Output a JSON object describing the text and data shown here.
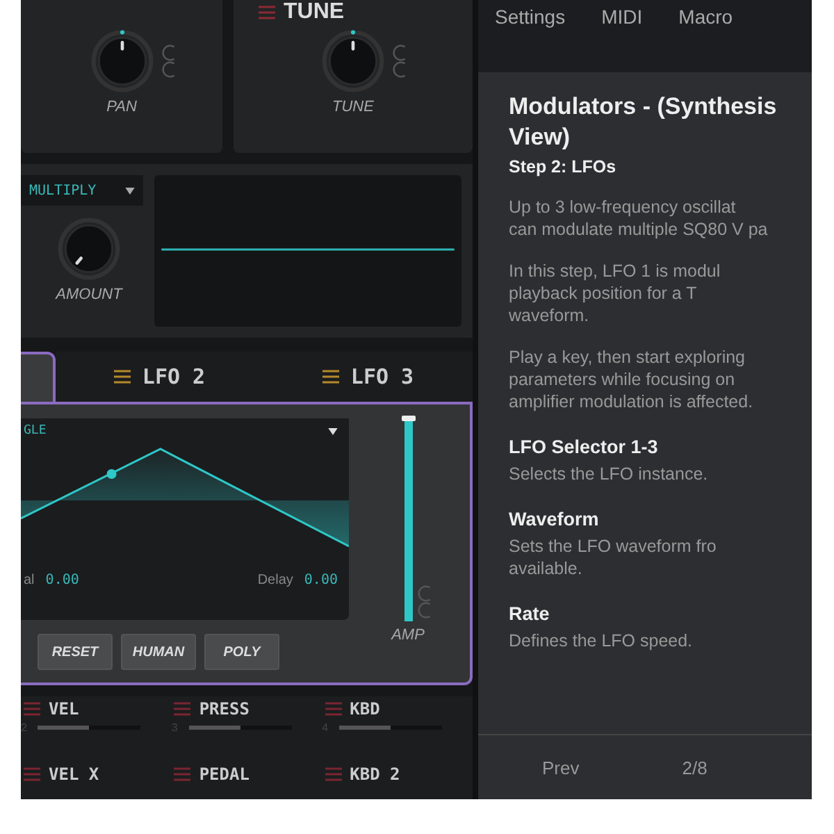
{
  "top_panels": [
    {
      "knob_label": "PAN"
    },
    {
      "header": "TUNE",
      "knob_label": "TUNE"
    }
  ],
  "mod_panel": {
    "mode_dropdown": "MULTIPLY",
    "knob_label": "AMOUNT"
  },
  "lfo_tabs": [
    {
      "selected": true
    },
    {
      "label": "LFO 2",
      "selected": false
    },
    {
      "label": "LFO 3",
      "selected": false
    }
  ],
  "lfo_panel": {
    "waveform_dropdown": "GLE",
    "left_param": {
      "label": "al",
      "value": "0.00"
    },
    "delay": {
      "label": "Delay",
      "value": "0.00"
    },
    "buttons": [
      "RESET",
      "HUMAN",
      "POLY"
    ],
    "amp_slider": {
      "label": "AMP",
      "level": 1.0
    }
  },
  "mod_sources": [
    {
      "name": "VEL",
      "number": "2",
      "level": 0.5
    },
    {
      "name": "PRESS",
      "number": "3",
      "level": 0.5
    },
    {
      "name": "KBD",
      "number": "4",
      "level": 0.5
    },
    {
      "name": "VEL X"
    },
    {
      "name": "PEDAL"
    },
    {
      "name": "KBD 2"
    }
  ],
  "tutorial": {
    "tabs": [
      "Settings",
      "MIDI",
      "Macro"
    ],
    "title": "Modulators - (Synthesis View)",
    "subtitle": "Step 2: LFOs",
    "paragraphs": [
      [
        "Up to 3 low-frequency oscillat",
        "can modulate multiple SQ80 V pa"
      ],
      [
        "In this step, LFO 1 is modul",
        "playback position for a T",
        "waveform."
      ],
      [
        "Play a key, then start exploring",
        "parameters while focusing on",
        "amplifier modulation is affected."
      ]
    ],
    "sections": [
      {
        "heading": "LFO Selector 1-3",
        "lines": [
          "Selects the LFO instance."
        ]
      },
      {
        "heading": "Waveform",
        "lines": [
          "Sets the LFO waveform fro",
          "available."
        ]
      },
      {
        "heading": "Rate",
        "lines": [
          "Defines the LFO speed."
        ]
      }
    ],
    "footer": {
      "prev": "Prev",
      "page": "2/8"
    }
  }
}
